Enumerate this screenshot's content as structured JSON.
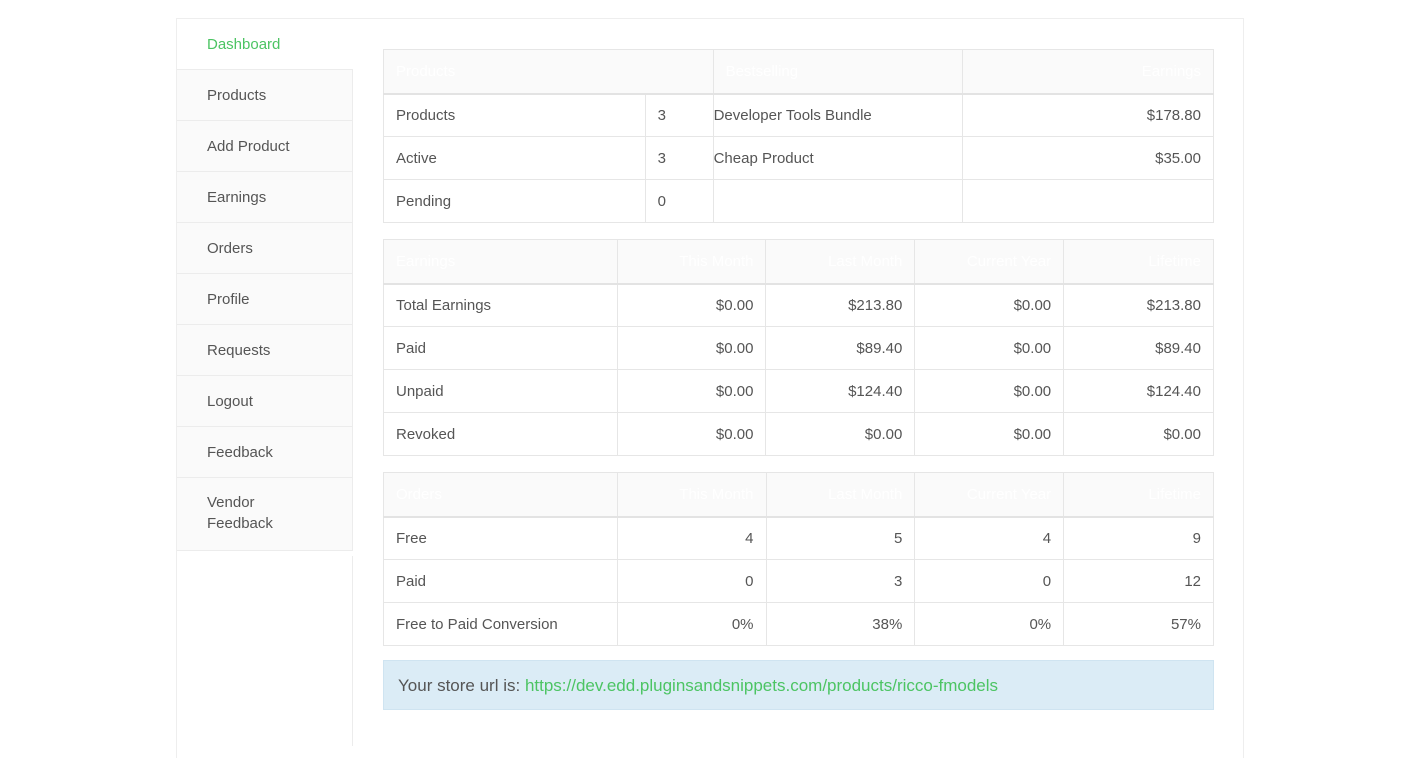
{
  "sidebar": {
    "items": [
      {
        "label": "Dashboard",
        "active": true
      },
      {
        "label": "Products"
      },
      {
        "label": "Add Product"
      },
      {
        "label": "Earnings"
      },
      {
        "label": "Orders"
      },
      {
        "label": "Profile"
      },
      {
        "label": "Requests"
      },
      {
        "label": "Logout"
      },
      {
        "label": "Feedback"
      },
      {
        "label": "Vendor Feedback"
      }
    ]
  },
  "products_table": {
    "headers": [
      "Products",
      "",
      "Bestselling",
      "Earnings"
    ],
    "rows": [
      {
        "label": "Products",
        "count": "3",
        "product": "Developer Tools Bundle",
        "earnings": "$178.80"
      },
      {
        "label": "Active",
        "count": "3",
        "product": "Cheap Product",
        "earnings": "$35.00"
      },
      {
        "label": "Pending",
        "count": "0",
        "product": "",
        "earnings": ""
      }
    ]
  },
  "earnings_table": {
    "headers": [
      "Earnings",
      "This Month",
      "Last Month",
      "Current Year",
      "Lifetime"
    ],
    "rows": [
      {
        "label": "Total Earnings",
        "values": [
          "$0.00",
          "$213.80",
          "$0.00",
          "$213.80"
        ]
      },
      {
        "label": "Paid",
        "values": [
          "$0.00",
          "$89.40",
          "$0.00",
          "$89.40"
        ]
      },
      {
        "label": "Unpaid",
        "values": [
          "$0.00",
          "$124.40",
          "$0.00",
          "$124.40"
        ]
      },
      {
        "label": "Revoked",
        "values": [
          "$0.00",
          "$0.00",
          "$0.00",
          "$0.00"
        ]
      }
    ]
  },
  "orders_table": {
    "headers": [
      "Orders",
      "This Month",
      "Last Month",
      "Current Year",
      "Lifetime"
    ],
    "rows": [
      {
        "label": "Free",
        "values": [
          "4",
          "5",
          "4",
          "9"
        ]
      },
      {
        "label": "Paid",
        "values": [
          "0",
          "3",
          "0",
          "12"
        ]
      },
      {
        "label": "Free to Paid Conversion",
        "values": [
          "0%",
          "38%",
          "0%",
          "57%"
        ]
      }
    ]
  },
  "store_notice": {
    "prefix": "Your store url is: ",
    "url": "https://dev.edd.pluginsandsnippets.com/products/ricco-fmodels"
  },
  "colors": {
    "accent": "#4cc463",
    "notice_bg": "#dbecf6"
  }
}
